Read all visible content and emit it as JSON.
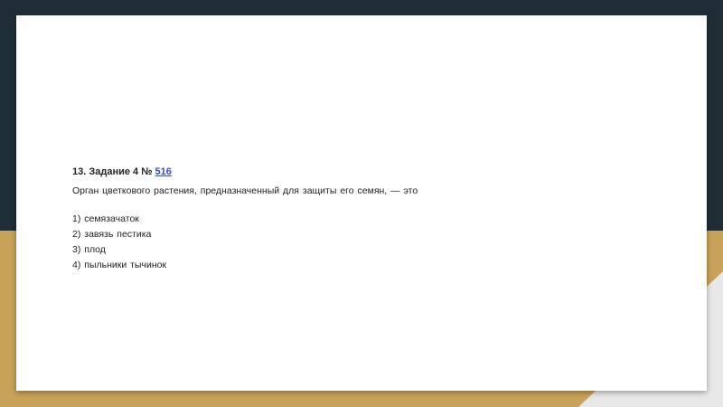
{
  "task": {
    "heading_prefix": "13. Задание 4 №",
    "task_link": "516",
    "question": "Орган цветкового растения, предназначенный для защиты его семян, — это"
  },
  "options": [
    "1) семязачаток",
    "2) завязь пестика",
    "3) плод",
    "4) пыльники тычинок"
  ],
  "colors": {
    "background_dark": "#1f2e36",
    "background_gold": "#c9a25a",
    "background_light": "#e8e8e8",
    "card": "#ffffff",
    "link": "#3a4fa0"
  }
}
